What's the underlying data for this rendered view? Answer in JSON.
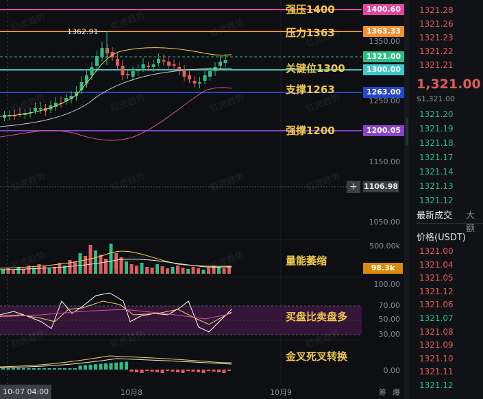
{
  "annotations": {
    "strong_resistance": "强压1400",
    "resistance": "压力1363",
    "key_level": "关键位1300",
    "support": "支撑1263",
    "strong_support": "强撑1200",
    "volume_note": "量能萎缩",
    "buy_sell_note": "买盘比卖盘多",
    "cross_note": "金叉死叉转换"
  },
  "price_tags": {
    "p1400": "1400.60",
    "p1363": "1363.33",
    "current": "1321.00",
    "p1300": "1300.00",
    "p1263": "1263.00",
    "p1200": "1200.05",
    "crosshair": "1106.98",
    "volume": "98.3k"
  },
  "high_marker": "1362.91",
  "axis": {
    "p1350": "1350.00",
    "p1250": "1250.00",
    "p1150": "1150.00",
    "p1050": "1050.00",
    "v500k": "500.00k",
    "r100": "100.00",
    "r70": "70.00",
    "r50": "50.00",
    "r30": "30.00",
    "m0": "0.00"
  },
  "time_axis": {
    "current": "10-07 04:00",
    "t1": "10月8",
    "t2": "10月9",
    "btn_a": "筹",
    "btn_b": "爆"
  },
  "watermark": "虹虎趋势",
  "orderbook": {
    "asks": [
      "1321.28",
      "1321.26",
      "1321.23",
      "1321.22",
      "1321.21"
    ],
    "last_price": "1,321.00",
    "last_sub": "$1,321.00",
    "bids": [
      "1321.20",
      "1321.19",
      "1321.18",
      "1321.17",
      "1321.14",
      "1321.13",
      "1321.12"
    ],
    "tab_latest": "最新成交",
    "tab_large": "大额",
    "price_header": "价格(USDT)",
    "trades": [
      {
        "p": "1321.00",
        "c": "#e05c5c"
      },
      {
        "p": "1321.04",
        "c": "#e05c5c"
      },
      {
        "p": "1321.05",
        "c": "#e05c5c"
      },
      {
        "p": "1321.12",
        "c": "#e05c5c"
      },
      {
        "p": "1321.06",
        "c": "#e05c5c"
      },
      {
        "p": "1321.07",
        "c": "#2ebd85"
      },
      {
        "p": "1321.08",
        "c": "#e05c5c"
      },
      {
        "p": "1321.09",
        "c": "#e05c5c"
      },
      {
        "p": "1321.10",
        "c": "#e05c5c"
      },
      {
        "p": "1321.11",
        "c": "#e05c5c"
      },
      {
        "p": "1321.12",
        "c": "#2ebd85"
      }
    ]
  },
  "colors": {
    "up": "#2ebd85",
    "down": "#e05c5c",
    "strong_res": "#e0479e",
    "res": "#f0902e",
    "key": "#3fc7c7",
    "support": "#2747c8",
    "strong_sup": "#8a44c9",
    "ma_fast": "#f2d35b",
    "ma_mid": "#c8c8c8",
    "ma_slow": "#d94fa0"
  }
}
